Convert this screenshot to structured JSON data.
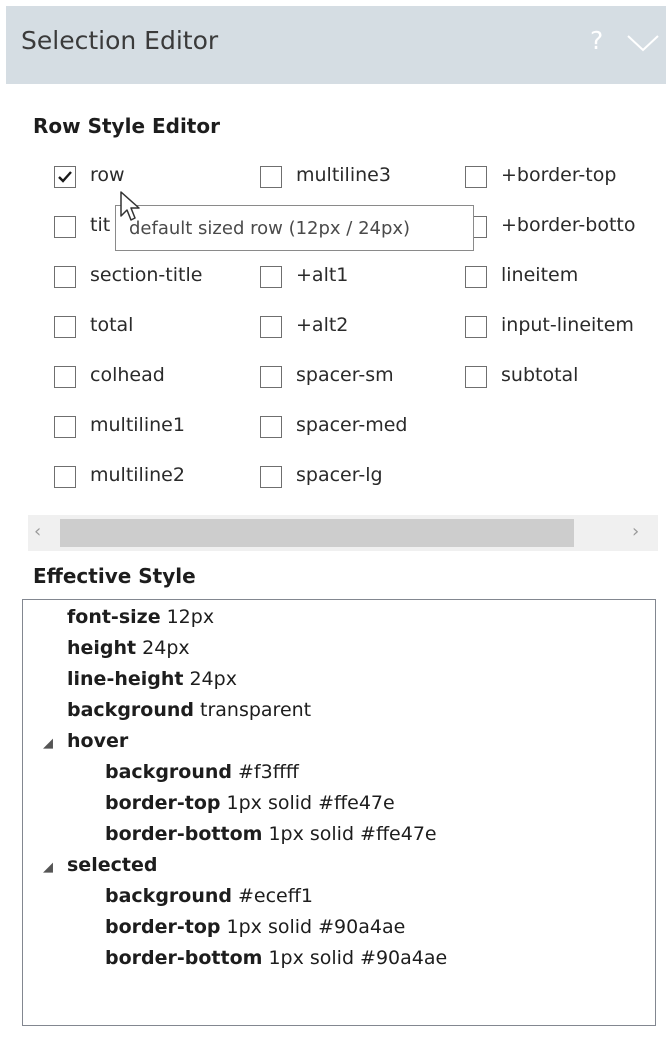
{
  "header": {
    "title": "Selection Editor",
    "help_label": "?"
  },
  "row_style_editor": {
    "heading": "Row Style Editor",
    "columns": [
      [
        {
          "label": "row",
          "checked": true
        },
        {
          "label": "tit",
          "checked": false
        },
        {
          "label": "section-title",
          "checked": false
        },
        {
          "label": "total",
          "checked": false
        },
        {
          "label": "colhead",
          "checked": false
        },
        {
          "label": "multiline1",
          "checked": false
        },
        {
          "label": "multiline2",
          "checked": false
        }
      ],
      [
        {
          "label": "multiline3",
          "checked": false
        },
        {
          "label": "",
          "checked": false
        },
        {
          "label": "+alt1",
          "checked": false
        },
        {
          "label": "+alt2",
          "checked": false
        },
        {
          "label": "spacer-sm",
          "checked": false
        },
        {
          "label": "spacer-med",
          "checked": false
        },
        {
          "label": "spacer-lg",
          "checked": false
        }
      ],
      [
        {
          "label": "+border-top",
          "checked": false
        },
        {
          "label": "+border-botto",
          "checked": false
        },
        {
          "label": "lineitem",
          "checked": false
        },
        {
          "label": "input-lineitem",
          "checked": false
        },
        {
          "label": "subtotal",
          "checked": false
        }
      ]
    ],
    "tooltip": "default sized row (12px / 24px)"
  },
  "effective_style": {
    "heading": "Effective Style",
    "props": [
      {
        "name": "font-size",
        "value": "12px"
      },
      {
        "name": "height",
        "value": "24px"
      },
      {
        "name": "line-height",
        "value": "24px"
      },
      {
        "name": "background",
        "value": "transparent"
      }
    ],
    "groups": [
      {
        "name": "hover",
        "props": [
          {
            "name": "background",
            "value": "#f3ffff"
          },
          {
            "name": "border-top",
            "value": "1px solid #ffe47e"
          },
          {
            "name": "border-bottom",
            "value": "1px solid #ffe47e"
          }
        ]
      },
      {
        "name": "selected",
        "props": [
          {
            "name": "background",
            "value": "#eceff1"
          },
          {
            "name": "border-top",
            "value": "1px solid #90a4ae"
          },
          {
            "name": "border-bottom",
            "value": "1px solid #90a4ae"
          }
        ]
      }
    ]
  }
}
